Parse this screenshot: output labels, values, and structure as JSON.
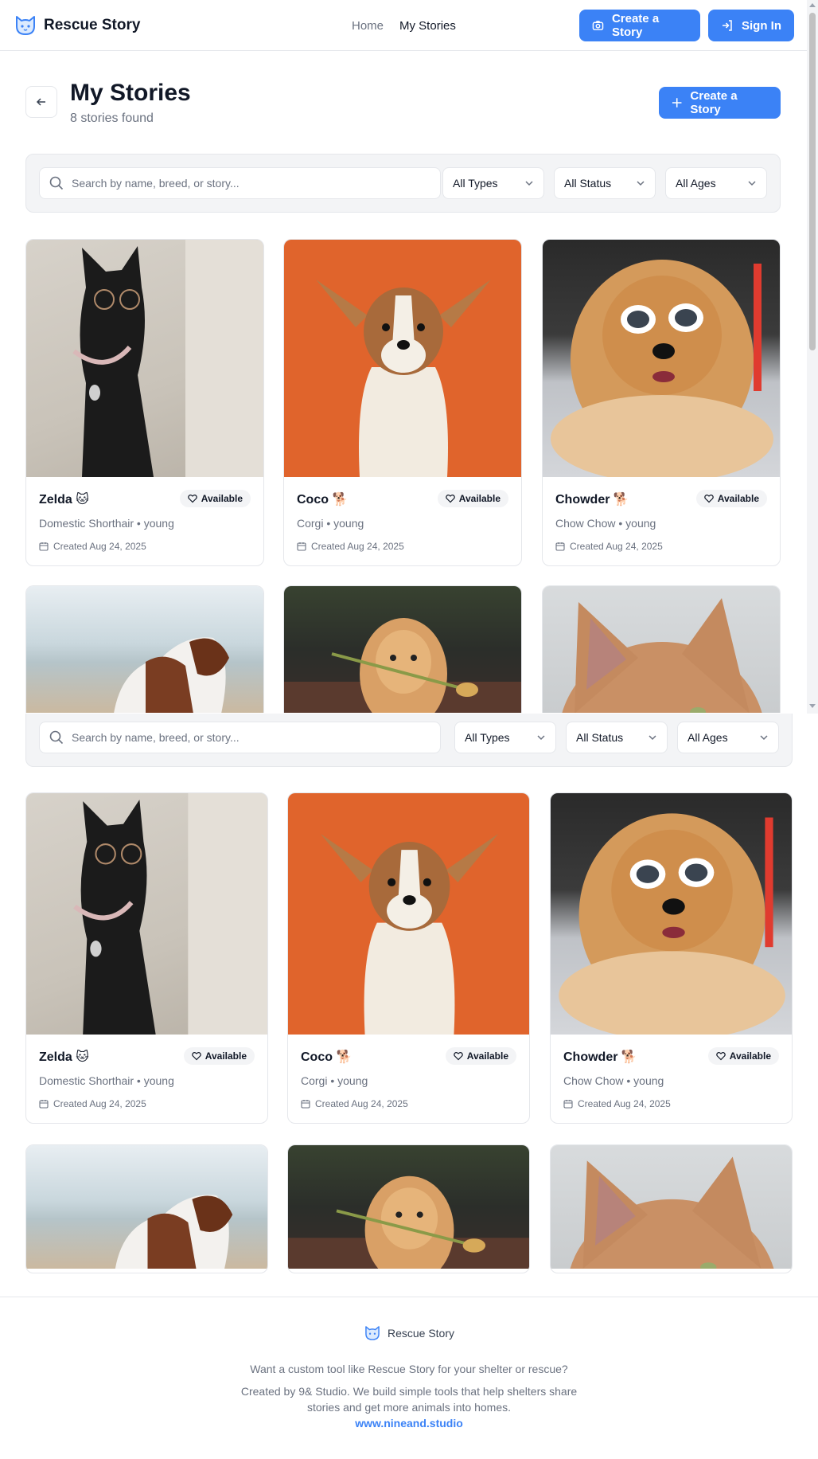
{
  "header": {
    "brand": "Rescue Story",
    "nav": {
      "home": "Home",
      "my_stories": "My Stories"
    },
    "create_label": "Create a Story",
    "signin_label": "Sign In"
  },
  "page": {
    "title": "My Stories",
    "subtitle": "8 stories found",
    "create_label": "Create a Story"
  },
  "filters": {
    "search_placeholder": "Search by name, breed, or story...",
    "type": "All Types",
    "status": "All Status",
    "age": "All Ages"
  },
  "pets": [
    {
      "name": "Zelda",
      "emoji": "🐱",
      "meta": "Domestic Shorthair • young",
      "status": "Available",
      "created": "Created Aug 24, 2025"
    },
    {
      "name": "Coco",
      "emoji": "🐕",
      "meta": "Corgi • young",
      "status": "Available",
      "created": "Created Aug 24, 2025"
    },
    {
      "name": "Chowder",
      "emoji": "🐕",
      "meta": "Chow Chow • young",
      "status": "Available",
      "created": "Created Aug 24, 2025"
    }
  ],
  "footer": {
    "brand": "Rescue Story",
    "line1": "Want a custom tool like Rescue Story for your shelter or rescue?",
    "line2": "Created by 9& Studio. We build simple tools that help shelters share",
    "line3": "stories and get more animals into homes.",
    "link": "www.nineand.studio"
  },
  "colors": {
    "accent": "#3b82f6",
    "text": "#111827",
    "muted": "#6b7280",
    "border": "#e5e7eb"
  }
}
